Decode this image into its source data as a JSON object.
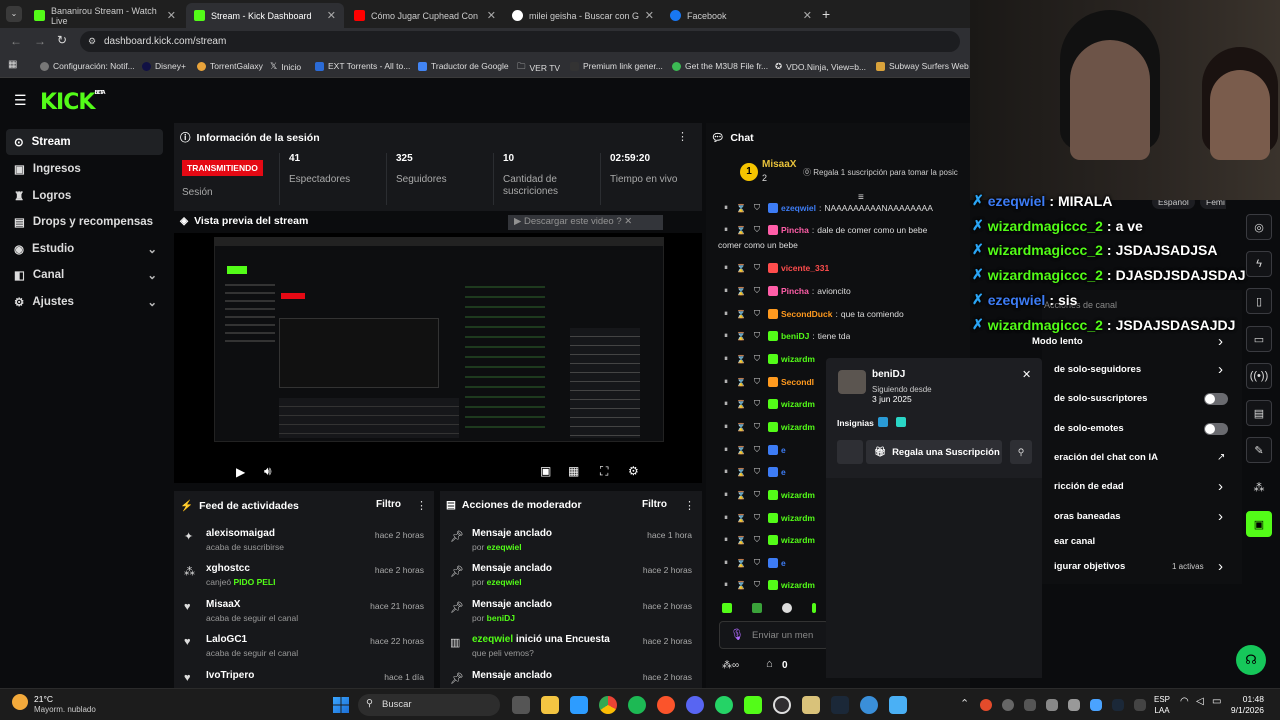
{
  "browser": {
    "tabs": [
      {
        "title": "Bananirou Stream - Watch Live",
        "color": "#53fc18"
      },
      {
        "title": "Stream - Kick Dashboard",
        "color": "#53fc18"
      },
      {
        "title": "Cómo Jugar Cuphead Con Ma",
        "color": "#ff0000"
      },
      {
        "title": "milei geisha - Buscar con Goog",
        "color": "#ffffff"
      },
      {
        "title": "Facebook",
        "color": "#1877f2"
      }
    ],
    "url": "dashboard.kick.com/stream",
    "bookmarks": [
      "Configuración: Notif...",
      "Disney+",
      "TorrentGalaxy",
      "Inicio",
      "EXT Torrents - All to...",
      "Traductor de Google",
      "VER TV",
      "Premium link gener...",
      "Get the M3U8 File fr...",
      "VDO.Ninja, View=b...",
      "Subway Surfers Web"
    ]
  },
  "kick": {
    "logo": "KICK",
    "logo_badge": "BETA",
    "nav": [
      {
        "label": "Stream",
        "icon": "stream-icon"
      },
      {
        "label": "Ingresos",
        "icon": "money-icon"
      },
      {
        "label": "Logros",
        "icon": "trophy-icon"
      },
      {
        "label": "Drops y recompensas",
        "icon": "gift-icon"
      },
      {
        "label": "Estudio",
        "icon": "studio-icon"
      },
      {
        "label": "Canal",
        "icon": "channel-icon"
      },
      {
        "label": "Ajustes",
        "icon": "settings-icon"
      }
    ],
    "session": {
      "title": "Información de la sesión",
      "live_badge": "TRANSMITIENDO",
      "live_label": "Sesión",
      "stats": [
        {
          "value": "41",
          "label": "Espectadores"
        },
        {
          "value": "325",
          "label": "Seguidores"
        },
        {
          "value": "10",
          "label": "Cantidad de suscriciones"
        },
        {
          "value": "02:59:20",
          "label": "Tiempo en vivo"
        }
      ]
    },
    "preview": {
      "title": "Vista previa del stream",
      "download": "Descargar este video"
    },
    "feed": {
      "title": "Feed de actividades",
      "filter": "Filtro",
      "items": [
        {
          "name": "alexisomaigad",
          "sub": "acaba de suscribirse",
          "time": "hace 2 horas"
        },
        {
          "name": "xghostcc",
          "sub": "canjeó",
          "sub_hl": "PIDO PELI",
          "time": "hace 2 horas"
        },
        {
          "name": "MisaaX",
          "sub": "acaba de seguir el canal",
          "time": "hace 21 horas"
        },
        {
          "name": "LaloGC1",
          "sub": "acaba de seguir el canal",
          "time": "hace 22 horas"
        },
        {
          "name": "IvoTripero",
          "sub": "",
          "time": "hace 1 día"
        }
      ]
    },
    "modactions": {
      "title": "Acciones de moderador",
      "filter": "Filtro",
      "items": [
        {
          "name": "Mensaje anclado",
          "sub": "por",
          "sub_hl": "ezeqwiel",
          "time": "hace 1 hora"
        },
        {
          "name": "Mensaje anclado",
          "sub": "por",
          "sub_hl": "ezeqwiel",
          "time": "hace 2 horas"
        },
        {
          "name": "Mensaje anclado",
          "sub": "por",
          "sub_hl": "beniDJ",
          "time": "hace 2 horas"
        },
        {
          "name_hl": "ezeqwiel",
          "name": " inició una Encuesta",
          "sub": "que peli vemos?",
          "time": "hace 2 horas"
        },
        {
          "name": "Mensaje anclado",
          "sub": "",
          "time": "hace 2 horas"
        }
      ]
    },
    "chat": {
      "title": "Chat",
      "top_user": "MisaaX",
      "top_count": "2",
      "gift_prompt": "Regala 1 suscripción para tomar la posic",
      "messages": [
        {
          "user": "ezeqwiel",
          "color": "#3d7cf5",
          "text": "NAAAAAAAAANAAAAAAAA"
        },
        {
          "user": "Pincha",
          "color": "#ff5ea8",
          "text": "dale de comer como un bebe"
        },
        {
          "user": "",
          "color": "#ffffff",
          "text": "comer como un bebe"
        },
        {
          "user": "vicente_331",
          "color": "#ff4d4d",
          "text": ""
        },
        {
          "user": "Pincha",
          "color": "#ff5ea8",
          "text": "avioncito"
        },
        {
          "user": "SecondDuck",
          "color": "#ff9a1f",
          "text": "que ta comiendo"
        },
        {
          "user": "beniDJ",
          "color": "#53fc18",
          "text": "tiene tda"
        },
        {
          "user": "wizardm",
          "color": "#53fc18",
          "text": ""
        },
        {
          "user": "SecondI",
          "color": "#ff9a1f",
          "text": ""
        },
        {
          "user": "wizardm",
          "color": "#53fc18",
          "text": ""
        },
        {
          "user": "wizardm",
          "color": "#53fc18",
          "text": ""
        },
        {
          "user": "e",
          "color": "#3d7cf5",
          "text": ""
        },
        {
          "user": "e",
          "color": "#3d7cf5",
          "text": ""
        },
        {
          "user": "wizardm",
          "color": "#53fc18",
          "text": ""
        },
        {
          "user": "wizardm",
          "color": "#53fc18",
          "text": ""
        },
        {
          "user": "wizardm",
          "color": "#53fc18",
          "text": ""
        },
        {
          "user": "e",
          "color": "#3d7cf5",
          "text": ""
        },
        {
          "user": "wizardm",
          "color": "#53fc18",
          "text": ""
        }
      ],
      "input_placeholder": "Enviar un men",
      "points": "0"
    },
    "usercard": {
      "name": "beniDJ",
      "following_label": "Siguiendo desde",
      "following_date": "3 jun 2025",
      "badges_label": "Insignias",
      "gift_button": "Regala una Suscripción"
    },
    "settings_menu": {
      "header": "Acciones de canal",
      "lang": "Español",
      "lang2": "Femi",
      "items": [
        {
          "label": "Modo lento",
          "control": "chevron"
        },
        {
          "label": "de solo-seguidores",
          "control": "chevron"
        },
        {
          "label": "de solo-suscriptores",
          "control": "toggle"
        },
        {
          "label": "de solo-emotes",
          "control": "toggle"
        },
        {
          "label": "eración del chat con IA",
          "control": "link"
        },
        {
          "label": "ricción de edad",
          "control": "chevron"
        },
        {
          "label": "oras baneadas",
          "control": "chevron"
        },
        {
          "label": "ear canal",
          "control": ""
        },
        {
          "label": "igurar objetivos",
          "control": "chevron",
          "extra": "1 activas"
        }
      ]
    }
  },
  "overlay_chat": [
    {
      "user": "ezeqwiel",
      "color": "#3d7cf5",
      "text": "MIRALA"
    },
    {
      "user": "wizardmagiccc_2",
      "color": "#53fc18",
      "text": "a ve"
    },
    {
      "user": "wizardmagiccc_2",
      "color": "#53fc18",
      "text": "JSDAJSADJSA"
    },
    {
      "user": "wizardmagiccc_2",
      "color": "#53fc18",
      "text": "DJASDJSDAJSDAJ"
    },
    {
      "user": "ezeqwiel",
      "color": "#3d7cf5",
      "text": "sis"
    },
    {
      "user": "wizardmagiccc_2",
      "color": "#53fc18",
      "text": "JSDAJSDASAJDJ"
    }
  ],
  "taskbar": {
    "weather_temp": "21°C",
    "weather_desc": "Mayorm. nublado",
    "search": "Buscar",
    "lang": "ESP",
    "lang2": "LAA",
    "time": "01:48",
    "date": "9/1/2026"
  }
}
